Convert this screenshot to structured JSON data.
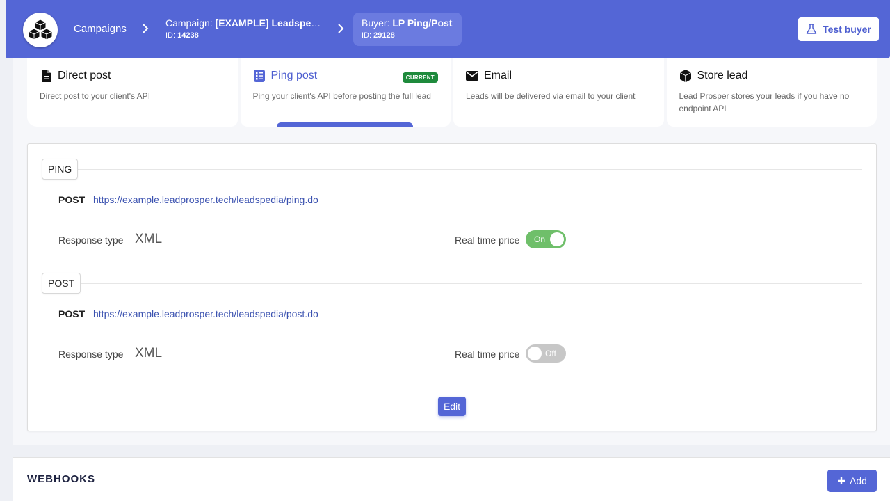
{
  "header": {
    "breadcrumbs": {
      "campaigns": "Campaigns",
      "campaign_prefix": "Campaign: ",
      "campaign_name": "[EXAMPLE] Leadspedia",
      "campaign_id_label": "ID: ",
      "campaign_id": "14238",
      "buyer_prefix": "Buyer: ",
      "buyer_name": "LP Ping/Post",
      "buyer_id_label": "ID: ",
      "buyer_id": "29128"
    },
    "test_buyer_label": "Test buyer"
  },
  "delivery_methods": [
    {
      "title": "Direct post",
      "description": "Direct post to your client's API",
      "icon": "document-icon"
    },
    {
      "title": "Ping post",
      "description": "Ping your client's API before posting the full lead",
      "icon": "list-icon",
      "badge": "CURRENT"
    },
    {
      "title": "Email",
      "description": "Leads will be delivered via email to your client",
      "icon": "envelope-icon"
    },
    {
      "title": "Store lead",
      "description": "Lead Prosper stores your leads if you have no endpoint API",
      "icon": "box-icon"
    }
  ],
  "ping": {
    "label": "PING",
    "method": "POST",
    "url": "https://example.leadprosper.tech/leadspedia/ping.do",
    "response_type_label": "Response type",
    "response_type": "XML",
    "real_time_price_label": "Real time price",
    "real_time_price": "On"
  },
  "post": {
    "label": "POST",
    "method": "POST",
    "url": "https://example.leadprosper.tech/leadspedia/post.do",
    "response_type_label": "Response type",
    "response_type": "XML",
    "real_time_price_label": "Real time price",
    "real_time_price": "Off"
  },
  "edit_label": "Edit",
  "webhooks": {
    "title": "WEBHOOKS",
    "add_label": "Add"
  },
  "colors": {
    "primary": "#5466d6",
    "success": "#1e8a3c",
    "toggle_on": "#6fbf6a",
    "toggle_off": "#c7c7c7"
  }
}
